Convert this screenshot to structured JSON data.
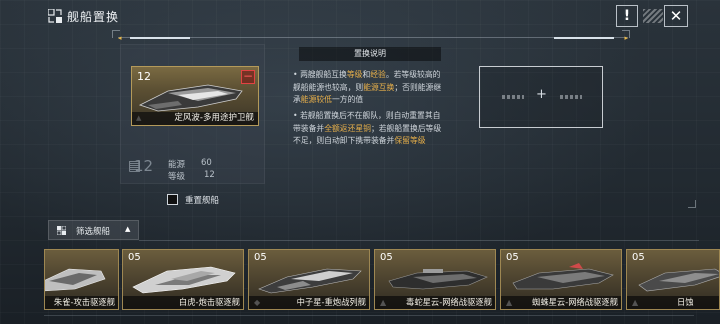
{
  "header": {
    "title": "舰船置换",
    "help_label": "!",
    "close_label": "✕"
  },
  "left_panel": {
    "selected_ship": {
      "level": "12",
      "name": "定风波-多用途护卫舰",
      "remove_label": "−"
    },
    "big_level": "12",
    "stats": {
      "energy_label": "能源",
      "energy_value": "60",
      "level_label": "等级",
      "level_value": "12"
    },
    "reset_label": "重置舰船"
  },
  "explanation": {
    "title": "置换说明",
    "para1": {
      "t1": "• 两艘舰船互换",
      "h1": "等级",
      "t2": "和",
      "h2": "经验",
      "t3": "。若等级较高的舰船能源也较高，则",
      "h3": "能源互换",
      "t4": "；否则能源继承",
      "h4": "能源较低",
      "t5": "一方的值"
    },
    "para2": {
      "t1": "• 若舰船置换后不在舰队，则自动重置其自带装备并",
      "h1": "全额返还星铜",
      "t2": "；若舰船置换后等级不足，则自动卸下携带装备并",
      "h2": "保留等级"
    }
  },
  "target_slot": {
    "plus": "+"
  },
  "filter": {
    "label": "筛选舰船",
    "caret": "▲"
  },
  "ship_list": [
    {
      "level": "",
      "name": "朱雀-攻击驱逐舰"
    },
    {
      "level": "05",
      "name": "白虎-炮击驱逐舰"
    },
    {
      "level": "05",
      "name": "中子星-重炮战列舰"
    },
    {
      "level": "05",
      "name": "毒蛇星云-网络战驱逐舰"
    },
    {
      "level": "05",
      "name": "蜘蛛星云-网络战驱逐舰"
    },
    {
      "level": "05",
      "name": "日蚀"
    }
  ],
  "colors": {
    "highlight": "#e8b04a",
    "card_border": "#b49a5a",
    "remove_red": "#e24242"
  }
}
